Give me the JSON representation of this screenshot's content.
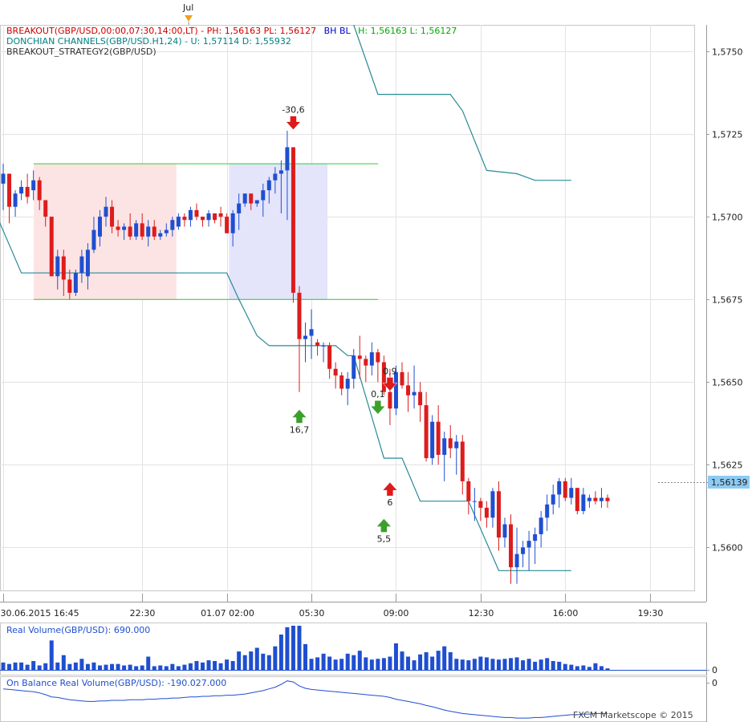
{
  "legend": {
    "line1_a": "BREAKOUT(GBP/USD,00:00,07:30,14:00,LT) -  PH: 1,56163  PL: 1,56127",
    "line1_b": "BH  BL",
    "line1_c": "H: 1,56163  L: 1,56127",
    "line2": "DONCHIAN CHANNELS(GBP/USD.H1,24) -  U: 1,57114  D: 1,55932",
    "line3": "BREAKOUT_STRATEGY2(GBP/USD)"
  },
  "top_marker": "Jul",
  "price_label": "1,56139",
  "volume_title": "Real Volume(GBP/USD): 690.000",
  "volume_zero": "0",
  "obv_title": "On Balance Real Volume(GBP/USD): -190.027.000",
  "obv_zero": "0",
  "watermark": "FXCM Marketscope © 2015",
  "colors": {
    "up": "#1f4fd0",
    "down": "#dd1c1c",
    "donchian": "#2a8a96",
    "boxGreen": "#33cc33",
    "boxPink": "#fde4e4",
    "boxBlue": "#e4e4fb",
    "legendRed": "#cc0000",
    "legendBlue": "#0000cc",
    "legendGreen": "#00aa00",
    "legendTeal": "#008080",
    "legendGray": "#333333",
    "priceTag": "#8ecbf2",
    "volume": "#1f4fd0",
    "obv": "#1f4fd0"
  },
  "chart_data": {
    "type": "candlestick",
    "symbol": "GBP/USD",
    "ylim": [
      1.5587,
      1.5758
    ],
    "y_ticks": [
      "1,5600",
      "1,5625",
      "1,5650",
      "1,5675",
      "1,5700",
      "1,5725",
      "1,5750"
    ],
    "y_tick_values": [
      1.56,
      1.5625,
      1.565,
      1.5675,
      1.57,
      1.5725,
      1.575
    ],
    "x_ticks": [
      "30.06.2015 16:45",
      "22:30",
      "01.07 02:00",
      "05:30",
      "09:00",
      "12:30",
      "16:00",
      "19:30"
    ],
    "x_tick_index": [
      0,
      23,
      37,
      51,
      65,
      79,
      93,
      107
    ],
    "candles": [
      [
        1.571,
        1.5716,
        1.5702,
        1.5713
      ],
      [
        1.5713,
        1.5713,
        1.5698,
        1.5703
      ],
      [
        1.5703,
        1.5708,
        1.57,
        1.5707
      ],
      [
        1.5707,
        1.5711,
        1.5705,
        1.5709
      ],
      [
        1.5709,
        1.5713,
        1.5704,
        1.5706
      ],
      [
        1.5708,
        1.5714,
        1.5705,
        1.5711
      ],
      [
        1.5711,
        1.5712,
        1.5702,
        1.5705
      ],
      [
        1.5705,
        1.5705,
        1.5697,
        1.57
      ],
      [
        1.57,
        1.57,
        1.5682,
        1.5682
      ],
      [
        1.5682,
        1.569,
        1.5678,
        1.5688
      ],
      [
        1.5688,
        1.569,
        1.5676,
        1.5681
      ],
      [
        1.5681,
        1.5684,
        1.5675,
        1.5677
      ],
      [
        1.5677,
        1.5684,
        1.5676,
        1.5683
      ],
      [
        1.5683,
        1.569,
        1.568,
        1.5688
      ],
      [
        1.5682,
        1.5692,
        1.5678,
        1.569
      ],
      [
        1.569,
        1.57,
        1.5689,
        1.5696
      ],
      [
        1.5694,
        1.5702,
        1.5691,
        1.57
      ],
      [
        1.57,
        1.5706,
        1.5697,
        1.5703
      ],
      [
        1.5703,
        1.5705,
        1.5695,
        1.5697
      ],
      [
        1.5697,
        1.5699,
        1.5694,
        1.5696
      ],
      [
        1.5696,
        1.5698,
        1.5693,
        1.5697
      ],
      [
        1.5697,
        1.5701,
        1.5693,
        1.5694
      ],
      [
        1.5694,
        1.5699,
        1.5693,
        1.5698
      ],
      [
        1.5698,
        1.5701,
        1.5693,
        1.5694
      ],
      [
        1.5694,
        1.5699,
        1.5691,
        1.5697
      ],
      [
        1.5697,
        1.5699,
        1.5693,
        1.5694
      ],
      [
        1.5694,
        1.5696,
        1.5693,
        1.5695
      ],
      [
        1.5695,
        1.5698,
        1.5694,
        1.5696
      ],
      [
        1.5696,
        1.57,
        1.5694,
        1.5699
      ],
      [
        1.5697,
        1.5701,
        1.5696,
        1.57
      ],
      [
        1.57,
        1.5701,
        1.5697,
        1.5699
      ],
      [
        1.5699,
        1.5703,
        1.5697,
        1.5702
      ],
      [
        1.5702,
        1.5704,
        1.5699,
        1.57
      ],
      [
        1.57,
        1.57,
        1.5697,
        1.5699
      ],
      [
        1.5699,
        1.5702,
        1.5697,
        1.5701
      ],
      [
        1.5701,
        1.5701,
        1.5698,
        1.5699
      ],
      [
        1.5701,
        1.5703,
        1.5697,
        1.57
      ],
      [
        1.57,
        1.5701,
        1.5695,
        1.5695
      ],
      [
        1.5695,
        1.5702,
        1.5691,
        1.5701
      ],
      [
        1.5701,
        1.5707,
        1.5696,
        1.5704
      ],
      [
        1.5704,
        1.5707,
        1.5703,
        1.5707
      ],
      [
        1.5707,
        1.5707,
        1.5702,
        1.5704
      ],
      [
        1.5704,
        1.5705,
        1.5703,
        1.5705
      ],
      [
        1.5705,
        1.571,
        1.57,
        1.5708
      ],
      [
        1.5708,
        1.5712,
        1.5704,
        1.5711
      ],
      [
        1.5711,
        1.5715,
        1.5707,
        1.5713
      ],
      [
        1.5713,
        1.5717,
        1.5701,
        1.5714
      ],
      [
        1.5714,
        1.5726,
        1.5699,
        1.5721
      ],
      [
        1.5721,
        1.5721,
        1.5674,
        1.5677
      ],
      [
        1.5677,
        1.5679,
        1.5647,
        1.5663
      ],
      [
        1.5663,
        1.5668,
        1.5656,
        1.5664
      ],
      [
        1.5664,
        1.5672,
        1.5657,
        1.5666
      ],
      [
        1.5662,
        1.5663,
        1.5658,
        1.5661
      ],
      [
        1.5661,
        1.5662,
        1.5656,
        1.5661
      ],
      [
        1.5661,
        1.5662,
        1.5651,
        1.5654
      ],
      [
        1.5654,
        1.5656,
        1.5648,
        1.5652
      ],
      [
        1.5652,
        1.5653,
        1.5646,
        1.5648
      ],
      [
        1.5648,
        1.5653,
        1.5643,
        1.5651
      ],
      [
        1.5651,
        1.566,
        1.5648,
        1.5658
      ],
      [
        1.5658,
        1.5664,
        1.5651,
        1.5657
      ],
      [
        1.5657,
        1.5658,
        1.565,
        1.5655
      ],
      [
        1.5655,
        1.5662,
        1.5652,
        1.5659
      ],
      [
        1.5659,
        1.566,
        1.565,
        1.5656
      ],
      [
        1.5656,
        1.5658,
        1.5646,
        1.5647
      ],
      [
        1.5647,
        1.5654,
        1.5637,
        1.5642
      ],
      [
        1.5642,
        1.5655,
        1.564,
        1.5653
      ],
      [
        1.5653,
        1.5656,
        1.5648,
        1.5649
      ],
      [
        1.5649,
        1.5653,
        1.5641,
        1.5646
      ],
      [
        1.5646,
        1.5655,
        1.5642,
        1.5647
      ],
      [
        1.5647,
        1.565,
        1.5638,
        1.5643
      ],
      [
        1.5643,
        1.5647,
        1.5626,
        1.5627
      ],
      [
        1.5627,
        1.564,
        1.5625,
        1.5638
      ],
      [
        1.5638,
        1.5643,
        1.5625,
        1.5628
      ],
      [
        1.5628,
        1.5635,
        1.562,
        1.5633
      ],
      [
        1.5633,
        1.5637,
        1.5627,
        1.563
      ],
      [
        1.563,
        1.5634,
        1.5622,
        1.5632
      ],
      [
        1.5632,
        1.5634,
        1.5616,
        1.562
      ],
      [
        1.562,
        1.5621,
        1.561,
        1.5614
      ],
      [
        1.5614,
        1.5618,
        1.5608,
        1.5614
      ],
      [
        1.5614,
        1.5615,
        1.5608,
        1.5612
      ],
      [
        1.5612,
        1.5614,
        1.5606,
        1.5609
      ],
      [
        1.5609,
        1.5618,
        1.5606,
        1.5617
      ],
      [
        1.5617,
        1.562,
        1.5599,
        1.5603
      ],
      [
        1.5603,
        1.5609,
        1.56,
        1.5607
      ],
      [
        1.5607,
        1.561,
        1.5589,
        1.5594
      ],
      [
        1.5594,
        1.5606,
        1.5589,
        1.5598
      ],
      [
        1.5598,
        1.5602,
        1.5594,
        1.56
      ],
      [
        1.56,
        1.5605,
        1.5593,
        1.5602
      ],
      [
        1.5602,
        1.5606,
        1.5595,
        1.5604
      ],
      [
        1.5604,
        1.5611,
        1.56,
        1.5609
      ],
      [
        1.5609,
        1.5616,
        1.5605,
        1.5613
      ],
      [
        1.5613,
        1.5619,
        1.561,
        1.5616
      ],
      [
        1.5616,
        1.5621,
        1.5612,
        1.562
      ],
      [
        1.562,
        1.5621,
        1.5614,
        1.5615
      ],
      [
        1.5615,
        1.5621,
        1.5613,
        1.5618
      ],
      [
        1.5618,
        1.5618,
        1.561,
        1.5611
      ],
      [
        1.5611,
        1.5618,
        1.561,
        1.5616
      ],
      [
        1.5614,
        1.5616,
        1.5612,
        1.5615
      ],
      [
        1.5615,
        1.5617,
        1.5613,
        1.5614
      ],
      [
        1.5614,
        1.5618,
        1.5612,
        1.5615
      ],
      [
        1.5615,
        1.5616,
        1.5612,
        1.5614
      ]
    ],
    "donchian_upper": [
      [
        58,
        1.5758
      ],
      [
        62,
        1.5737
      ],
      [
        74,
        1.5737
      ],
      [
        76,
        1.5732
      ],
      [
        80,
        1.5714
      ],
      [
        85,
        1.5713
      ],
      [
        88,
        1.5711
      ],
      [
        94,
        1.5711
      ]
    ],
    "donchian_lower": [
      [
        -4,
        1.57
      ],
      [
        -1,
        1.57
      ],
      [
        3,
        1.5683
      ],
      [
        37,
        1.5683
      ],
      [
        39,
        1.5675
      ],
      [
        42,
        1.5664
      ],
      [
        44,
        1.5661
      ],
      [
        55,
        1.5661
      ],
      [
        57,
        1.5658
      ],
      [
        58,
        1.5658
      ],
      [
        63,
        1.5627
      ],
      [
        66,
        1.5627
      ],
      [
        69,
        1.5614
      ],
      [
        77,
        1.5614
      ],
      [
        82,
        1.5593
      ],
      [
        94,
        1.5593
      ]
    ],
    "breakout_box": {
      "high": 1.5716,
      "low": 1.5675,
      "pink_from": 0,
      "pink_to": 28,
      "blue_from": 29,
      "blue_to": 51
    },
    "annotations": [
      {
        "text": "-30,6",
        "index": 48,
        "price": 1.5728,
        "arrow": "down",
        "color": "red"
      },
      {
        "text": "16,7",
        "index": 49,
        "price": 1.564,
        "arrow": "up",
        "color": "green"
      },
      {
        "text": "0,9",
        "index": 64,
        "price": 1.5649,
        "arrow": "down",
        "color": "red"
      },
      {
        "text": "0,1",
        "index": 62,
        "price": 1.5642,
        "arrow": "down",
        "color": "green"
      },
      {
        "text": "5,5",
        "index": 63,
        "price": 1.5607,
        "arrow": "up",
        "color": "green"
      },
      {
        "text": "6",
        "index": 64,
        "price": 1.5618,
        "arrow": "up",
        "color": "red"
      }
    ],
    "volume": [
      1,
      0.8,
      1,
      1,
      0.7,
      1.2,
      0.6,
      0.9,
      4,
      1,
      2,
      0.8,
      1,
      1.5,
      0.8,
      1,
      0.6,
      0.7,
      0.8,
      0.8,
      0.6,
      0.7,
      0.5,
      0.6,
      1.8,
      0.5,
      0.6,
      0.5,
      0.8,
      0.5,
      0.7,
      0.9,
      1.2,
      1,
      1.3,
      1.2,
      0.9,
      1.4,
      1.2,
      2.5,
      2,
      2.5,
      3,
      2.2,
      2,
      3.2,
      4.8,
      5.8,
      6,
      6,
      3.5,
      1.5,
      1.7,
      2.2,
      1.8,
      1.4,
      1.5,
      2.2,
      2,
      2.6,
      1.7,
      1.4,
      1.5,
      1.6,
      1.8,
      3.6,
      2.5,
      1.8,
      1.3,
      2.1,
      2.4,
      1.8,
      2.6,
      3.2,
      2.4,
      1.5,
      1.4,
      1.3,
      1.5,
      1.8,
      1.7,
      1.5,
      1.4,
      1.5,
      1.6,
      1.7,
      1.3,
      1.5,
      1.1,
      1.4,
      1.6,
      1.2,
      1.1,
      0.8,
      0.7,
      0.5,
      0.6,
      0.4,
      0.9,
      0.5,
      0.2
    ],
    "obv": [
      -0.5,
      -0.6,
      -0.7,
      -0.8,
      -0.9,
      -1.0,
      -1.2,
      -1.5,
      -1.9,
      -2.0,
      -2.2,
      -2.4,
      -2.5,
      -2.6,
      -2.7,
      -2.7,
      -2.6,
      -2.6,
      -2.5,
      -2.5,
      -2.5,
      -2.4,
      -2.4,
      -2.4,
      -2.3,
      -2.3,
      -2.2,
      -2.2,
      -2.1,
      -2.1,
      -2.0,
      -1.9,
      -1.9,
      -1.8,
      -1.8,
      -1.7,
      -1.7,
      -1.6,
      -1.6,
      -1.5,
      -1.4,
      -1.2,
      -1.0,
      -0.8,
      -0.5,
      -0.2,
      0.3,
      0.9,
      0.7,
      0.0,
      -0.4,
      -0.6,
      -0.7,
      -0.8,
      -0.9,
      -1.0,
      -1.1,
      -1.2,
      -1.3,
      -1.4,
      -1.5,
      -1.6,
      -1.7,
      -1.8,
      -2.0,
      -2.3,
      -2.5,
      -2.7,
      -2.9,
      -3.1,
      -3.4,
      -3.6,
      -3.9,
      -4.2,
      -4.4,
      -4.6,
      -4.8,
      -4.9,
      -5.0,
      -5.1,
      -5.2,
      -5.3,
      -5.4,
      -5.5,
      -5.5,
      -5.6,
      -5.6,
      -5.6,
      -5.5,
      -5.5,
      -5.4,
      -5.3,
      -5.2,
      -5.1,
      -5.0,
      -5.0,
      -4.9,
      -4.9,
      -4.8,
      -4.8,
      -4.8
    ]
  }
}
